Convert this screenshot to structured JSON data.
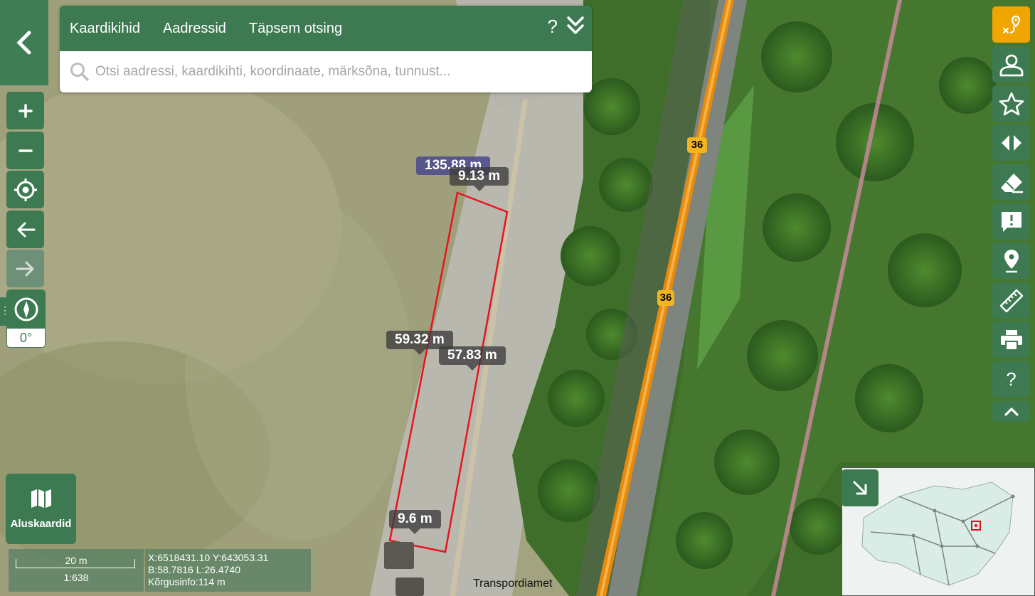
{
  "header": {
    "back_icon": "chevron-left-icon",
    "tabs": [
      {
        "label": "Kaardikihid"
      },
      {
        "label": "Aadressid"
      },
      {
        "label": "Täpsem otsing"
      }
    ],
    "help_label": "?",
    "collapse_icon": "double-chevron-down-icon"
  },
  "search": {
    "placeholder": "Otsi aadressi, kaardikihti, koordinaate, märksõna, tunnust...",
    "value": ""
  },
  "left_tools": [
    {
      "name": "zoom-in",
      "icon": "plus-icon"
    },
    {
      "name": "zoom-out",
      "icon": "minus-icon"
    },
    {
      "name": "locate",
      "icon": "crosshair-icon"
    },
    {
      "name": "history-back",
      "icon": "arrow-left-icon"
    },
    {
      "name": "history-forward",
      "icon": "arrow-right-icon",
      "disabled": true
    }
  ],
  "compass": {
    "rotation": "0°",
    "icon": "compass-icon"
  },
  "right_tools": [
    {
      "name": "route",
      "icon": "route-pin-icon",
      "active": true
    },
    {
      "name": "account",
      "icon": "user-icon"
    },
    {
      "name": "favorites",
      "icon": "star-icon"
    },
    {
      "name": "compare",
      "icon": "swap-arrows-icon"
    },
    {
      "name": "eraser",
      "icon": "eraser-icon"
    },
    {
      "name": "feedback",
      "icon": "comment-alert-icon"
    },
    {
      "name": "marker",
      "icon": "map-pin-icon"
    },
    {
      "name": "measure",
      "icon": "ruler-icon"
    },
    {
      "name": "print",
      "icon": "printer-icon"
    },
    {
      "name": "help",
      "icon": "question-icon",
      "label": "?"
    }
  ],
  "basemap": {
    "label": "Aluskaardid",
    "icon": "map-icon"
  },
  "scale": {
    "distance": "20 m",
    "ratio": "1:638"
  },
  "coordinates": {
    "xy": "X:6518431.10 Y:643053.31",
    "bl": "B:58.7816 L:26.4740",
    "height": "Kõrgusinfo:114 m"
  },
  "measurements": {
    "total": "135.88 m",
    "top": "9.13 m",
    "left": "59.32 m",
    "right": "57.83 m",
    "bottom": "9.6 m"
  },
  "road_labels": {
    "primary": "36",
    "secondary": "36"
  },
  "attribution": "Transpordiamet",
  "colors": {
    "brand_green": "#3d7a52",
    "active_orange": "#f0a500",
    "measure_red": "#e8141e",
    "road_orange": "#e88a0c"
  }
}
